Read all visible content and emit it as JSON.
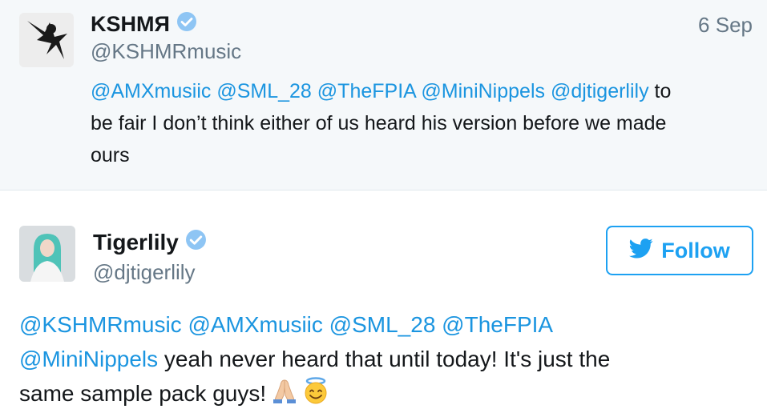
{
  "tweet1": {
    "name": "KSHMЯ",
    "handle": "@KSHMRmusic",
    "date": "6 Sep",
    "mentions": [
      "@AMXmusiic",
      "@SML_28",
      "@TheFPIA",
      "@MiniNippels",
      "@djtigerlily"
    ],
    "text_rest_line1": " to",
    "text_line2": "be fair I don’t think either of us heard his version before we made",
    "text_line3": "ours"
  },
  "tweet2": {
    "name": "Tigerlily",
    "handle": "@djtigerlily",
    "follow_label": "Follow",
    "mentions_line1": [
      "@KSHMRmusic",
      "@AMXmusiic",
      "@SML_28",
      "@TheFPIA"
    ],
    "mention_line2": "@MiniNippels",
    "text_line2_rest": " yeah never heard that until today! It's just the",
    "text_line3": "same sample pack guys! ",
    "emojis": [
      "folded-hands-icon",
      "smiling-face-with-halo-icon"
    ]
  },
  "colors": {
    "link": "#1b95e0",
    "follow_blue": "#1da1f2",
    "verified_blue": "#1da1f2",
    "top_background": "#f5f8fa"
  }
}
